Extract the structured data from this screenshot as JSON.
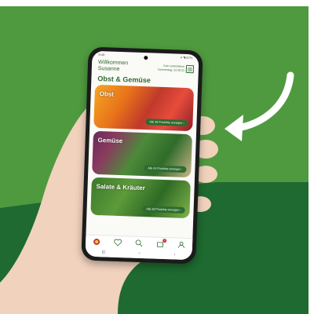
{
  "statusbar": {
    "time": "9:40",
    "right": "▾ ◥ 87%"
  },
  "header": {
    "greeting_line1": "Willkommen",
    "greeting_line2": "Susanne",
    "shop_line1": "Dein Lieferdatum",
    "shop_line2": "Donnerstag, 22.09.22"
  },
  "section_title": "Obst & Gemüse",
  "cards": [
    {
      "label": "Obst",
      "button": "Alle 36 Produkte anzeigen  ›"
    },
    {
      "label": "Gemüse",
      "button": "Alle 42 Produkte anzeigen  ›"
    },
    {
      "label": "Salate & Kräuter",
      "button": "Alle 28 Produkte anzeigen  ›"
    }
  ],
  "nav": {
    "cart_badge": "2"
  },
  "colors": {
    "brand_green": "#2e6b2f",
    "bg_green": "#4f9a3f",
    "bg_dark_green": "#1e6a30"
  },
  "icons": [
    "home-icon",
    "heart-icon",
    "search-icon",
    "cart-icon",
    "profile-icon"
  ]
}
